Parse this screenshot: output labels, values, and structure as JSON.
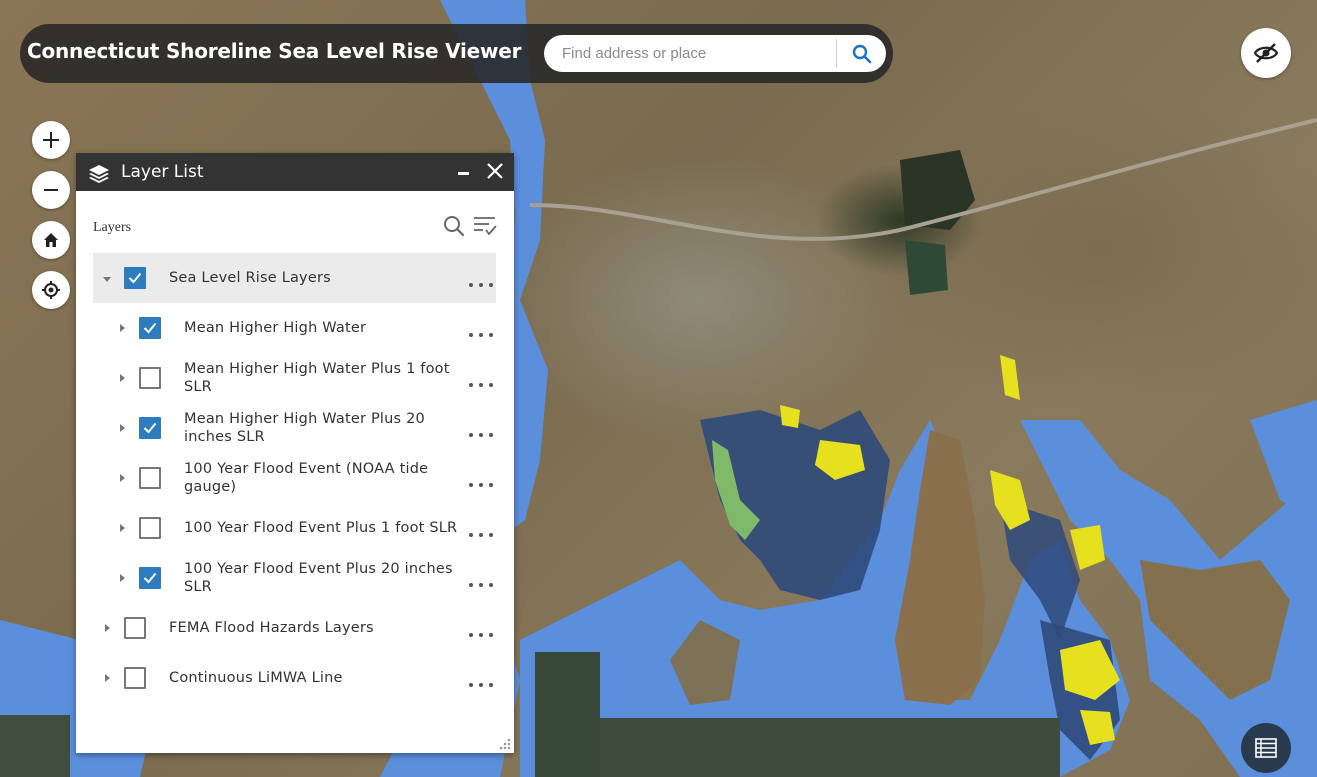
{
  "app": {
    "title": "Connecticut Shoreline Sea Level Rise Viewer"
  },
  "search": {
    "placeholder": "Find address or place",
    "value": ""
  },
  "icons": {
    "search": "search-icon",
    "visibility": "eye-off-icon",
    "zoom_in": "plus-icon",
    "zoom_out": "minus-icon",
    "home": "home-icon",
    "locate": "locate-icon",
    "attribute_table": "table-icon",
    "panel": "layers-icon",
    "minimize": "minimize-icon",
    "close": "close-icon",
    "layer_search": "search-icon",
    "layer_filter": "filter-list-icon",
    "more": "more-dots-icon"
  },
  "layer_panel": {
    "title": "Layer List",
    "layers_label": "Layers",
    "items": [
      {
        "label": "Sea Level Rise Layers",
        "checked": true,
        "expanded": true,
        "level": 0
      },
      {
        "label": "Mean Higher High Water",
        "checked": true,
        "expanded": false,
        "level": 1
      },
      {
        "label": "Mean Higher High Water Plus 1 foot SLR",
        "checked": false,
        "expanded": false,
        "level": 1
      },
      {
        "label": "Mean Higher High Water Plus 20 inches SLR",
        "checked": true,
        "expanded": false,
        "level": 1
      },
      {
        "label": "100 Year Flood Event (NOAA tide gauge)",
        "checked": false,
        "expanded": false,
        "level": 1
      },
      {
        "label": "100 Year Flood Event Plus 1 foot SLR",
        "checked": false,
        "expanded": false,
        "level": 1
      },
      {
        "label": "100 Year Flood Event Plus 20 inches SLR",
        "checked": true,
        "expanded": false,
        "level": 1
      },
      {
        "label": "FEMA Flood Hazards Layers",
        "checked": false,
        "expanded": false,
        "level": 0
      },
      {
        "label": "Continuous LiMWA Line",
        "checked": false,
        "expanded": false,
        "level": 0
      }
    ]
  },
  "colors": {
    "header_bg": "#282828",
    "panel_header_bg": "#333333",
    "checkbox_checked": "#2e7cc0",
    "water": "#5b8fdc",
    "flood_yellow": "#e6e01e",
    "flood_navy": "#2f4a7a",
    "attribute_button": "#2a3a4e"
  }
}
